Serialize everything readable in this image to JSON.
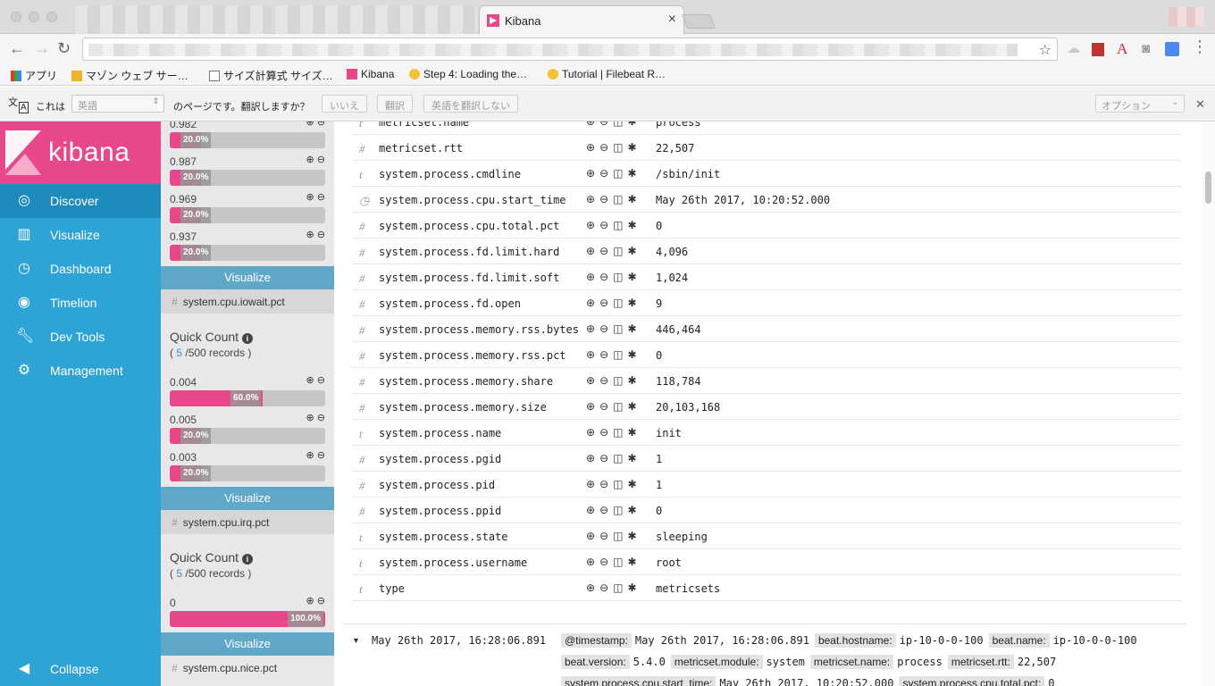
{
  "browser": {
    "active_tab_title": "Kibana",
    "tab_close": "×",
    "bookmarks": [
      {
        "label": "アプリ"
      },
      {
        "label": "マゾン ウェブ サー…"
      },
      {
        "label": "サイズ計算式 サイズ…"
      },
      {
        "label": "Kibana"
      },
      {
        "label": "Step 4: Loading the…"
      },
      {
        "label": "Tutorial | Filebeat R…"
      }
    ]
  },
  "translate": {
    "prefix": "これは",
    "language": "英語",
    "question": "のページです。翻訳しますか？",
    "no_button": "いいえ",
    "translate_button": "翻訳",
    "never_button": "英語を翻訳しない",
    "options": "オプション"
  },
  "kibana": {
    "logo_text": "kibana",
    "nav": [
      {
        "label": "Discover",
        "active": true
      },
      {
        "label": "Visualize"
      },
      {
        "label": "Dashboard"
      },
      {
        "label": "Timelion"
      },
      {
        "label": "Dev Tools"
      },
      {
        "label": "Management"
      }
    ],
    "collapse_label": "Collapse"
  },
  "field_panel": {
    "top_values": [
      {
        "value": "0.982",
        "percent": "",
        "fraction": 0.2
      },
      {
        "value": "0.987",
        "percent": "20.0%",
        "fraction": 0.2
      },
      {
        "value": "0.969",
        "percent": "20.0%",
        "fraction": 0.2
      },
      {
        "value": "0.937",
        "percent": "20.0%",
        "fraction": 0.2
      }
    ],
    "visualize_label": "Visualize",
    "iowait": {
      "field_name": "system.cpu.iowait.pct",
      "quick_count": "Quick Count",
      "sample_open": "( ",
      "sample_count": "5",
      "sample_close": " /500 records )",
      "values": [
        {
          "value": "0.004",
          "percent": "60.0%",
          "fraction": 0.6
        },
        {
          "value": "0.005",
          "percent": "20.0%",
          "fraction": 0.2
        },
        {
          "value": "0.003",
          "percent": "20.0%",
          "fraction": 0.2
        }
      ]
    },
    "irq": {
      "field_name": "system.cpu.irq.pct",
      "quick_count": "Quick Count",
      "sample_open": "( ",
      "sample_count": "5",
      "sample_close": " /500 records )",
      "values": [
        {
          "value": "0",
          "percent": "100.0%",
          "fraction": 1.0
        }
      ]
    },
    "nice_field_name": "system.cpu.nice.pct"
  },
  "document": {
    "fields": [
      {
        "type": "t",
        "name": "metricset.name",
        "value": "process"
      },
      {
        "type": "#",
        "name": "metricset.rtt",
        "value": "22,507"
      },
      {
        "type": "t",
        "name": "system.process.cmdline",
        "value": "/sbin/init"
      },
      {
        "type": "clock",
        "name": "system.process.cpu.start_time",
        "value": "May 26th 2017, 10:20:52.000"
      },
      {
        "type": "#",
        "name": "system.process.cpu.total.pct",
        "value": "0"
      },
      {
        "type": "#",
        "name": "system.process.fd.limit.hard",
        "value": "4,096"
      },
      {
        "type": "#",
        "name": "system.process.fd.limit.soft",
        "value": "1,024"
      },
      {
        "type": "#",
        "name": "system.process.fd.open",
        "value": "9"
      },
      {
        "type": "#",
        "name": "system.process.memory.rss.bytes",
        "value": "446,464"
      },
      {
        "type": "#",
        "name": "system.process.memory.rss.pct",
        "value": "0"
      },
      {
        "type": "#",
        "name": "system.process.memory.share",
        "value": "118,784"
      },
      {
        "type": "#",
        "name": "system.process.memory.size",
        "value": "20,103,168"
      },
      {
        "type": "t",
        "name": "system.process.name",
        "value": "init"
      },
      {
        "type": "#",
        "name": "system.process.pgid",
        "value": "1"
      },
      {
        "type": "#",
        "name": "system.process.pid",
        "value": "1"
      },
      {
        "type": "#",
        "name": "system.process.ppid",
        "value": "0"
      },
      {
        "type": "t",
        "name": "system.process.state",
        "value": "sleeping"
      },
      {
        "type": "t",
        "name": "system.process.username",
        "value": "root"
      },
      {
        "type": "t",
        "name": "type",
        "value": "metricsets"
      }
    ],
    "next_hit": {
      "timestamp": "May 26th 2017, 16:28:06.891",
      "lines": [
        [
          {
            "k": "@timestamp:",
            "v": "May 26th 2017, 16:28:06.891"
          },
          {
            "k": "beat.hostname:",
            "v": "ip-10-0-0-100"
          },
          {
            "k": "beat.name:",
            "v": "ip-10-0-0-100"
          }
        ],
        [
          {
            "k": "beat.version:",
            "v": "5.4.0"
          },
          {
            "k": "metricset.module:",
            "v": "system"
          },
          {
            "k": "metricset.name:",
            "v": "process"
          },
          {
            "k": "metricset.rtt:",
            "v": "22,507"
          }
        ],
        [
          {
            "k": "system.process.cpu.start_time:",
            "v": "May 26th 2017, 10:20:52.000"
          },
          {
            "k": "system.process.cpu.total.pct:",
            "v": "0"
          }
        ]
      ]
    }
  },
  "colors": {
    "kibana_pink": "#e8488b",
    "sidebar_blue": "#2ea4d6",
    "active_nav": "#1e8bbd",
    "visualize_button": "#5fa8c8"
  }
}
